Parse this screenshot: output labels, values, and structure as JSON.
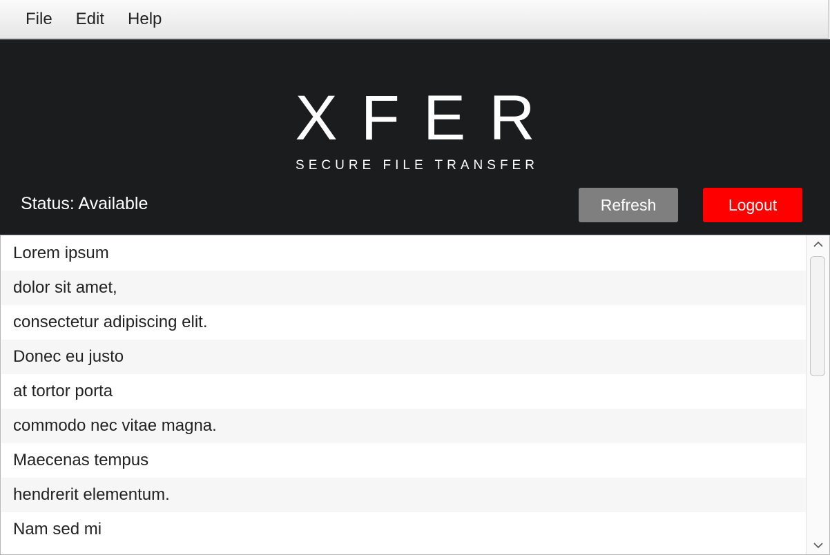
{
  "menubar": {
    "items": [
      {
        "label": "File"
      },
      {
        "label": "Edit"
      },
      {
        "label": "Help"
      }
    ]
  },
  "header": {
    "logo": "XFER",
    "tagline": "SECURE FILE TRANSFER",
    "status": "Status: Available",
    "refresh_label": "Refresh",
    "logout_label": "Logout",
    "colors": {
      "background": "#1b1c1e",
      "refresh": "#7f7f7f",
      "logout": "#ff0000"
    }
  },
  "list": {
    "items": [
      "Lorem ipsum",
      "dolor sit amet,",
      "consectetur adipiscing elit.",
      "Donec eu justo",
      "at tortor porta",
      "commodo nec vitae magna.",
      "Maecenas tempus",
      "hendrerit elementum.",
      "Nam sed mi"
    ]
  },
  "scrollbar": {
    "up_icon": "chevron-up-icon",
    "down_icon": "chevron-down-icon"
  }
}
